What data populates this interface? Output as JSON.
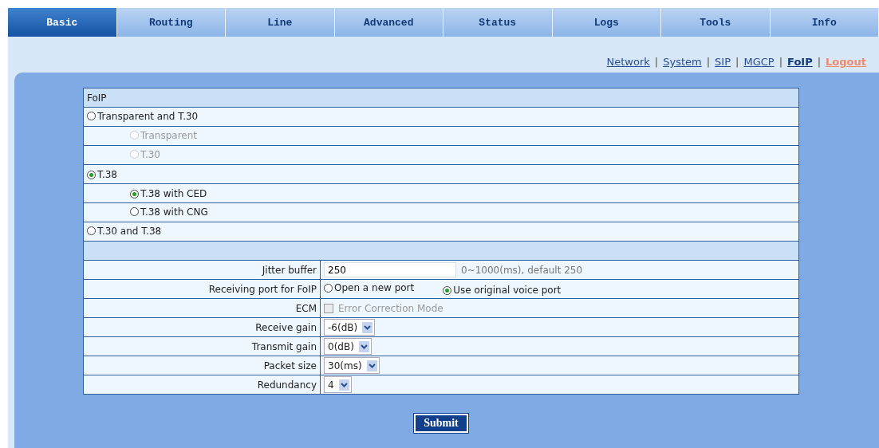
{
  "tabs": [
    {
      "label": "Basic",
      "selected": true
    },
    {
      "label": "Routing",
      "selected": false
    },
    {
      "label": "Line",
      "selected": false
    },
    {
      "label": "Advanced",
      "selected": false
    },
    {
      "label": "Status",
      "selected": false
    },
    {
      "label": "Logs",
      "selected": false
    },
    {
      "label": "Tools",
      "selected": false
    },
    {
      "label": "Info",
      "selected": false
    }
  ],
  "subnav": [
    {
      "kind": "link",
      "label": "Network",
      "selected": false
    },
    {
      "kind": "separator",
      "label": "|"
    },
    {
      "kind": "link",
      "label": "System",
      "selected": false
    },
    {
      "kind": "separator",
      "label": "|"
    },
    {
      "kind": "link",
      "label": "SIP",
      "selected": false
    },
    {
      "kind": "separator",
      "label": "|"
    },
    {
      "kind": "link",
      "label": "MGCP",
      "selected": false
    },
    {
      "kind": "separator",
      "label": "|"
    },
    {
      "kind": "link",
      "label": "FoIP",
      "selected": true
    },
    {
      "kind": "separator",
      "label": "|"
    },
    {
      "kind": "logout",
      "label": "Logout"
    }
  ],
  "section_title": "FoIP",
  "modes": [
    {
      "label": "Transparent and T.30",
      "selected": false,
      "disabled": false,
      "children": [
        {
          "label": "Transparent",
          "selected": false,
          "disabled": true
        },
        {
          "label": "T.30",
          "selected": false,
          "disabled": true
        }
      ]
    },
    {
      "label": "T.38",
      "selected": true,
      "disabled": false,
      "children": [
        {
          "label": "T.38 with CED",
          "selected": true,
          "disabled": false
        },
        {
          "label": "T.38 with CNG",
          "selected": false,
          "disabled": false
        }
      ]
    },
    {
      "label": "T.30 and T.38",
      "selected": false,
      "disabled": false
    }
  ],
  "settings": [
    {
      "kind": "text",
      "label": "Jitter buffer",
      "value": "250",
      "hint": "0~1000(ms), default 250"
    },
    {
      "kind": "radio",
      "label": "Receiving port for FoIP",
      "options": [
        {
          "label": "Open a new port",
          "selected": false
        },
        {
          "label": "Use original voice port",
          "selected": true
        }
      ]
    },
    {
      "kind": "checkbox",
      "label": "ECM",
      "option": "Error Correction Mode",
      "checked": false,
      "disabled": true
    },
    {
      "kind": "select",
      "label": "Receive gain",
      "value": "-6(dB)"
    },
    {
      "kind": "select",
      "label": "Transmit gain",
      "value": "0(dB)"
    },
    {
      "kind": "select",
      "label": "Packet size",
      "value": "30(ms)"
    },
    {
      "kind": "select",
      "label": "Redundancy",
      "value": "4"
    }
  ],
  "submit": "Submit"
}
